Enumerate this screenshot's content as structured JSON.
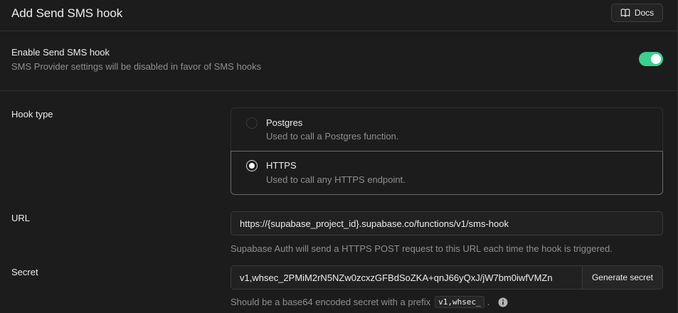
{
  "header": {
    "title": "Add Send SMS hook",
    "docs_label": "Docs"
  },
  "enable": {
    "title": "Enable Send SMS hook",
    "description": "SMS Provider settings will be disabled in favor of SMS hooks",
    "enabled": true
  },
  "hook_type": {
    "label": "Hook type",
    "options": [
      {
        "title": "Postgres",
        "description": "Used to call a Postgres function.",
        "selected": false
      },
      {
        "title": "HTTPS",
        "description": "Used to call any HTTPS endpoint.",
        "selected": true
      }
    ]
  },
  "url": {
    "label": "URL",
    "value": "https://{supabase_project_id}.supabase.co/functions/v1/sms-hook",
    "help": "Supabase Auth will send a HTTPS POST request to this URL each time the hook is triggered."
  },
  "secret": {
    "label": "Secret",
    "value": "v1,whsec_2PMiM2rN5NZw0zcxzGFBdSoZKA+qnJ66yQxJ/jW7bm0iwfVMZn",
    "generate_label": "Generate secret",
    "help_prefix": "Should be a base64 encoded secret with a prefix",
    "help_code": "v1,whsec_",
    "help_suffix": "."
  },
  "colors": {
    "accent": "#3ecf8e",
    "background": "#1c1c1c"
  }
}
